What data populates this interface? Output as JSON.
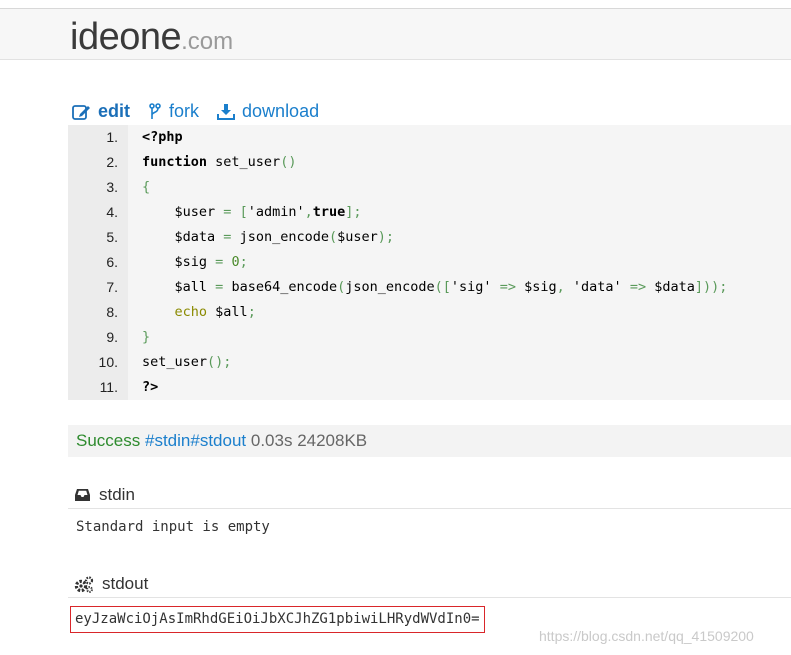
{
  "brand": {
    "name": "ideone",
    "tld": ".com"
  },
  "actions": [
    {
      "label": "edit",
      "icon": "edit-icon"
    },
    {
      "label": "fork",
      "icon": "fork-icon"
    },
    {
      "label": "download",
      "icon": "download-icon"
    }
  ],
  "code": {
    "line_numbers": [
      "1.",
      "2.",
      "3.",
      "4.",
      "5.",
      "6.",
      "7.",
      "8.",
      "9.",
      "10.",
      "11."
    ]
  },
  "result": {
    "status": "Success",
    "stdin_tag": "#stdin",
    "stdout_tag": "#stdout",
    "time": "0.03s",
    "memory": "24208KB"
  },
  "stdin": {
    "title": "stdin",
    "icon": "inbox-icon",
    "content": "Standard input is empty"
  },
  "stdout": {
    "title": "stdout",
    "icon": "gears-icon",
    "content": "eyJzaWciOjAsImRhdGEiOiJbXCJhZG1pbiwiLHRydWVdIn0="
  },
  "watermark": "https://blog.csdn.net/qq_41509200",
  "colors": {
    "link": "#1b7fcc",
    "success": "#2e8b2e",
    "highlight_border": "#d9262a"
  }
}
